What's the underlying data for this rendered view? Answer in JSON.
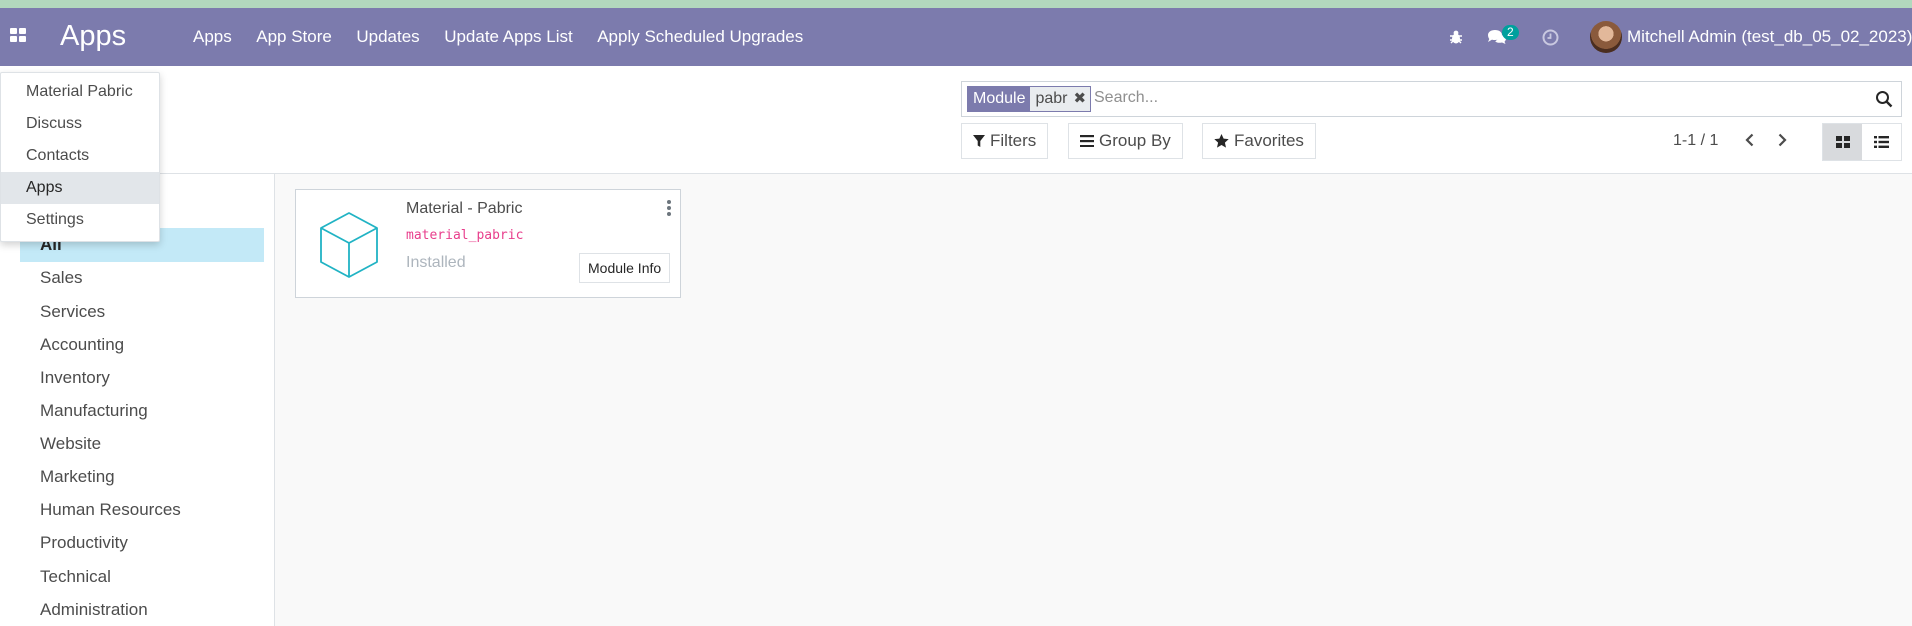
{
  "navbar": {
    "brand": "Apps",
    "menu": [
      "Apps",
      "App Store",
      "Updates",
      "Update Apps List",
      "Apply Scheduled Upgrades"
    ],
    "messages_count": "2",
    "user": "Mitchell Admin (test_db_05_02_2023)",
    "icons": [
      "apps-grid-icon",
      "bug-icon",
      "chat-icon",
      "clock-icon"
    ],
    "color": "#7c7bad"
  },
  "app_menu_dropdown": {
    "items": [
      "Material Pabric",
      "Discuss",
      "Contacts",
      "Apps",
      "Settings"
    ],
    "active": "Apps"
  },
  "search": {
    "facet_label": "Module",
    "facet_value": "pabr",
    "placeholder": "Search..."
  },
  "toolbar": {
    "filters": "Filters",
    "group_by": "Group By",
    "favorites": "Favorites",
    "pager": "1-1 / 1",
    "active_view": "kanban"
  },
  "sidebar": {
    "items": [
      "All",
      "Sales",
      "Services",
      "Accounting",
      "Inventory",
      "Manufacturing",
      "Website",
      "Marketing",
      "Human Resources",
      "Productivity",
      "Technical",
      "Administration"
    ],
    "active": "All"
  },
  "module_card": {
    "title": "Material - Pabric",
    "technical_name": "material_pabric",
    "status": "Installed",
    "button": "Module Info"
  }
}
